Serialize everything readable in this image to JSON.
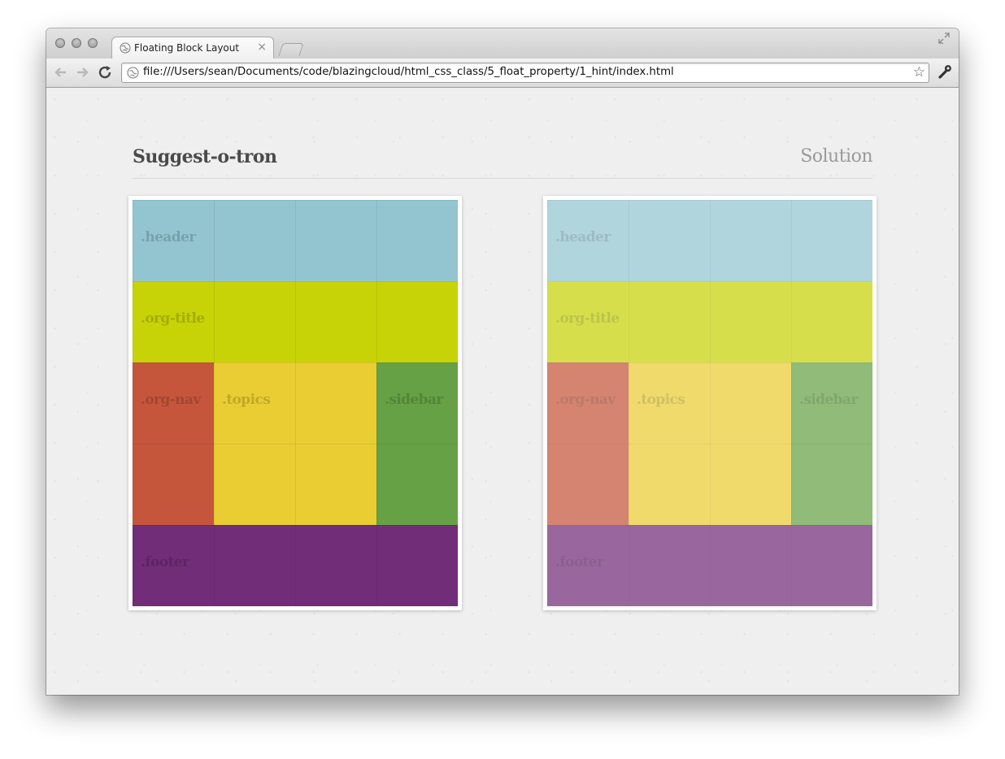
{
  "browser": {
    "tab_title": "Floating Block Layout",
    "tab_close": "×",
    "url": "file:///Users/sean/Documents/code/blazingcloud/html_css_class/5_float_property/1_hint/index.html",
    "bookmark_star": "☆"
  },
  "page": {
    "title": "Suggest-o-tron",
    "solution_label": "Solution"
  },
  "blocks": {
    "header": ".header",
    "org_title": ".org-title",
    "org_nav": ".org-nav",
    "topics": ".topics",
    "sidebar": ".sidebar",
    "footer": ".footer"
  },
  "colors": {
    "header": "#93c5d1",
    "org_title": "#c7d307",
    "org_nav": "#c5563c",
    "topics": "#eacd33",
    "sidebar": "#66a145",
    "footer": "#722d78"
  },
  "icons": {
    "traffic_lights": [
      "close-light",
      "minimize-light",
      "zoom-light"
    ],
    "tab": "globe-icon",
    "back": "back-arrow-icon",
    "forward": "forward-arrow-icon",
    "reload": "reload-icon",
    "page_info": "page-info-icon",
    "bookmark": "star-icon",
    "menu": "wrench-icon",
    "fullscreen": "fullscreen-icon"
  }
}
